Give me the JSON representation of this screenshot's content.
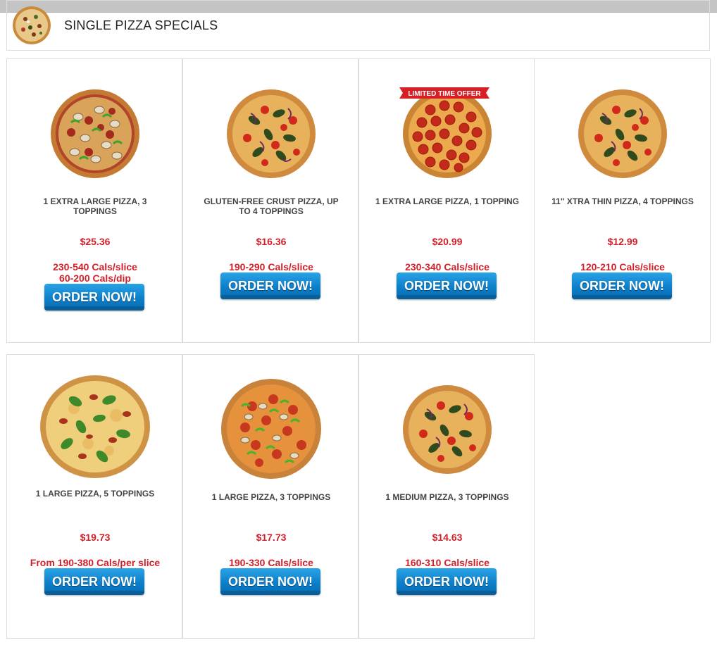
{
  "header": {
    "title": "SINGLE PIZZA SPECIALS",
    "logo_icon": "pizza-logo-icon"
  },
  "colors": {
    "price_red": "#d0202a",
    "button_blue": "#0c7fcb",
    "lto_red": "#d91f26"
  },
  "order_label": "ORDER NOW!",
  "cards": [
    {
      "name": "1 EXTRA LARGE PIZZA, 3 TOPPINGS",
      "price": "$25.36",
      "cals": "230-540 Cals/slice",
      "cals2": "60-200 Cals/dip",
      "badge": "",
      "image_icon": "pizza-mushroom-pepper-icon"
    },
    {
      "name": "GLUTEN-FREE CRUST PIZZA, UP TO 4 TOPPINGS",
      "price": "$16.36",
      "cals": "190-290 Cals/slice",
      "cals2": "",
      "badge": "",
      "image_icon": "pizza-veggie-tomato-icon"
    },
    {
      "name": "1 EXTRA LARGE PIZZA, 1 TOPPING",
      "price": "$20.99",
      "cals": "230-340 Cals/slice",
      "cals2": "",
      "badge": "LIMITED TIME OFFER",
      "image_icon": "pizza-pepperoni-icon"
    },
    {
      "name": "11\" XTRA THIN PIZZA, 4 TOPPINGS",
      "price": "$12.99",
      "cals": "120-210 Cals/slice",
      "cals2": "",
      "badge": "",
      "image_icon": "pizza-veggie-tomato-icon"
    },
    {
      "name": "1 LARGE PIZZA, 5 TOPPINGS",
      "price": "$19.73",
      "cals": "From 190-380 Cals/per slice",
      "cals2": "",
      "badge": "",
      "image_icon": "pizza-basil-cheese-icon"
    },
    {
      "name": "1 LARGE PIZZA, 3 TOPPINGS",
      "price": "$17.73",
      "cals": "190-330 Cals/slice",
      "cals2": "",
      "badge": "",
      "image_icon": "pizza-pepperoni-pepper-icon"
    },
    {
      "name": "1 MEDIUM PIZZA, 3 TOPPINGS",
      "price": "$14.63",
      "cals": "160-310 Cals/slice",
      "cals2": "",
      "badge": "",
      "image_icon": "pizza-veggie-tomato-icon"
    }
  ]
}
